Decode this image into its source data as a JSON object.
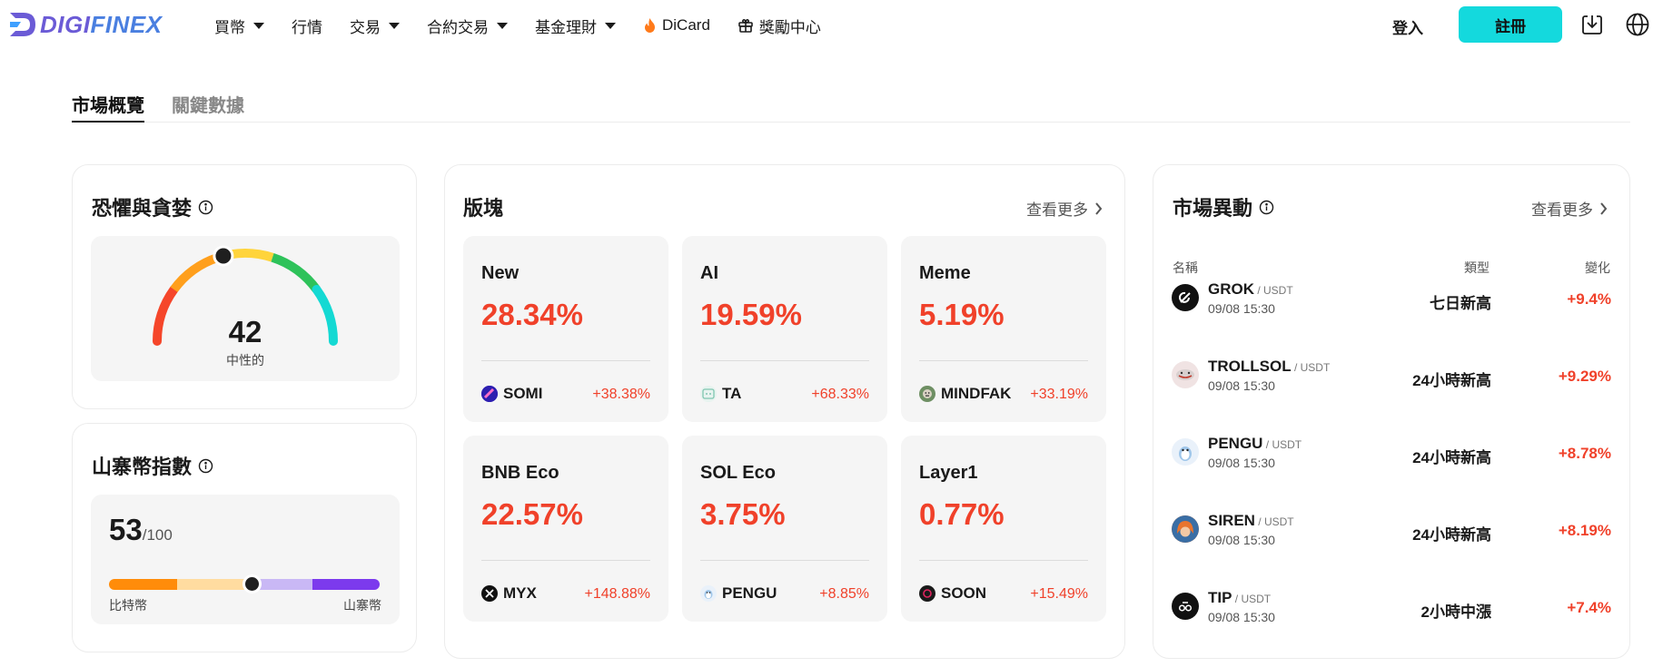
{
  "nav": {
    "logo": "DIGIFINEX",
    "items": [
      {
        "label": "買幣",
        "caret": true
      },
      {
        "label": "行情",
        "caret": false
      },
      {
        "label": "交易",
        "caret": true
      },
      {
        "label": "合約交易",
        "caret": true
      },
      {
        "label": "基金理財",
        "caret": true
      },
      {
        "label": "DiCard",
        "icon": "fire-icon"
      },
      {
        "label": "獎勵中心",
        "icon": "gift-icon"
      }
    ],
    "login": "登入",
    "register": "註冊"
  },
  "tabs": [
    "市場概覽",
    "關鍵數據"
  ],
  "fear_greed": {
    "title": "恐懼與貪婪",
    "value": "42",
    "label": "中性的",
    "level": 42
  },
  "altcoin": {
    "title": "山寨幣指數",
    "value": "53",
    "max": "/100",
    "left_label": "比特幣",
    "right_label": "山寨幣",
    "level": 53
  },
  "sectors": {
    "title": "版塊",
    "more": "查看更多",
    "items": [
      {
        "name": "New",
        "pct": "28.34%",
        "coin": "SOMI",
        "change": "+38.38%",
        "icon_color": "#3b2bd0"
      },
      {
        "name": "AI",
        "pct": "19.59%",
        "coin": "TA",
        "change": "+68.33%",
        "icon_color": "#e7f3ef"
      },
      {
        "name": "Meme",
        "pct": "5.19%",
        "coin": "MINDFAK",
        "change": "+33.19%",
        "icon_color": "#6e8f63"
      },
      {
        "name": "BNB Eco",
        "pct": "22.57%",
        "coin": "MYX",
        "change": "+148.88%",
        "icon_color": "#111111"
      },
      {
        "name": "SOL Eco",
        "pct": "3.75%",
        "coin": "PENGU",
        "change": "+8.85%",
        "icon_color": "#e9f1fa"
      },
      {
        "name": "Layer1",
        "pct": "0.77%",
        "coin": "SOON",
        "change": "+15.49%",
        "icon_color": "#1a1a1a"
      }
    ]
  },
  "movers": {
    "title": "市場異動",
    "more": "查看更多",
    "headers": {
      "name": "名稱",
      "type": "類型",
      "change": "變化"
    },
    "rows": [
      {
        "symbol": "GROK",
        "pair": " / USDT",
        "time": "09/08 15:30",
        "type": "七日新高",
        "change": "+9.4%",
        "icon_color": "#111111"
      },
      {
        "symbol": "TROLLSOL",
        "pair": " / USDT",
        "time": "09/08 15:30",
        "type": "24小時新高",
        "change": "+9.29%",
        "icon_color": "#f0e3e3"
      },
      {
        "symbol": "PENGU",
        "pair": " / USDT",
        "time": "09/08 15:30",
        "type": "24小時新高",
        "change": "+8.78%",
        "icon_color": "#e9f1fa"
      },
      {
        "symbol": "SIREN",
        "pair": " / USDT",
        "time": "09/08 15:30",
        "type": "24小時新高",
        "change": "+8.19%",
        "icon_color": "#e8742e"
      },
      {
        "symbol": "TIP",
        "pair": " / USDT",
        "time": "09/08 15:30",
        "type": "2小時中漲",
        "change": "+7.4%",
        "icon_color": "#111111"
      }
    ]
  },
  "colors": {
    "accent": "#14d9dd",
    "up": "#f0412a"
  }
}
